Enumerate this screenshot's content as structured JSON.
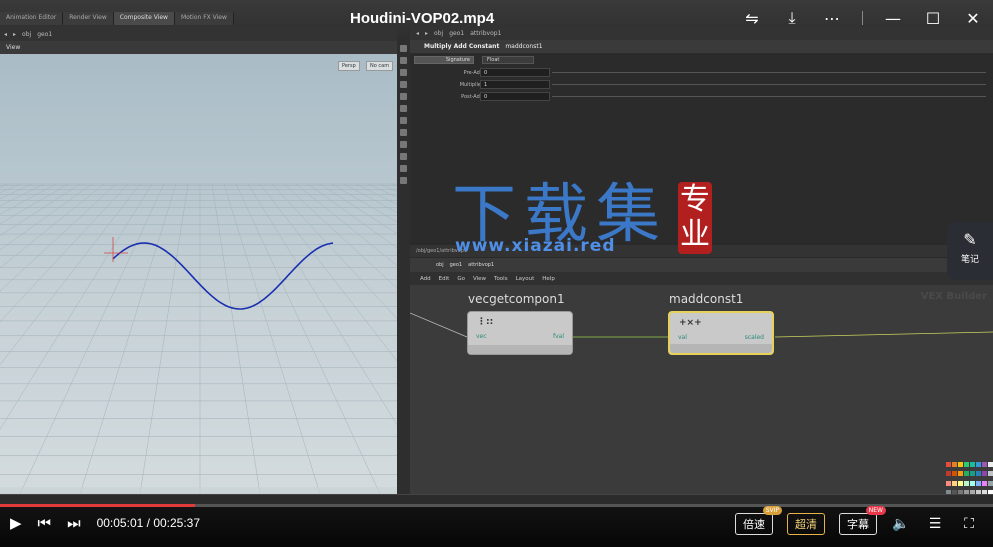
{
  "player": {
    "title": "Houdini-VOP02.mp4",
    "time_current": "00:05:01",
    "time_total": "00:25:37",
    "progress": 0.196,
    "speed_label": "倍速",
    "speed_badge": "SVIP",
    "quality_label": "超清",
    "subtitle_label": "字幕",
    "subtitle_badge": "NEW",
    "note_label": "笔记"
  },
  "houdini": {
    "top_tabs": [
      "Animation Editor",
      "Render View",
      "Composite View",
      "Motion FX View"
    ],
    "viewport": {
      "path_obj": "obj",
      "path_geo": "geo1",
      "label": "View",
      "persp_btn": "Persp",
      "nocam_btn": "No cam"
    },
    "params": {
      "path_obj": "obj",
      "path_geo": "geo1",
      "path_vop": "attribvop1",
      "node_type": "Multiply Add Constant",
      "node_name": "maddconst1",
      "signature_label": "Signature",
      "signature_value": "Float",
      "rows": [
        {
          "label": "Pre-Add",
          "value": "0"
        },
        {
          "label": "Multiplier",
          "value": "1"
        },
        {
          "label": "Post-Add",
          "value": "0"
        }
      ]
    },
    "network": {
      "tab": "/obj/geo1/attribvop1",
      "path_obj": "obj",
      "path_geo": "geo1",
      "path_vop": "attribvop1",
      "menu": [
        "Add",
        "Edit",
        "Go",
        "View",
        "Tools",
        "Layout",
        "Help"
      ],
      "context_label": "VEX Builder",
      "nodes": [
        {
          "name": "vecgetcompon1",
          "in": "vec",
          "out": "fval",
          "glyph": "⋮::"
        },
        {
          "name": "maddconst1",
          "in": "val",
          "out": "scaled",
          "glyph": "+×+"
        }
      ]
    }
  },
  "watermark": {
    "text": "下载集",
    "seal": "专业",
    "url": "www.xiazai.red"
  },
  "colors": {
    "accent_red": "#e03a3a",
    "curve_blue": "#1a2fb0",
    "watermark_blue": "#3d7fd6",
    "selected_node": "#e6d25a"
  }
}
